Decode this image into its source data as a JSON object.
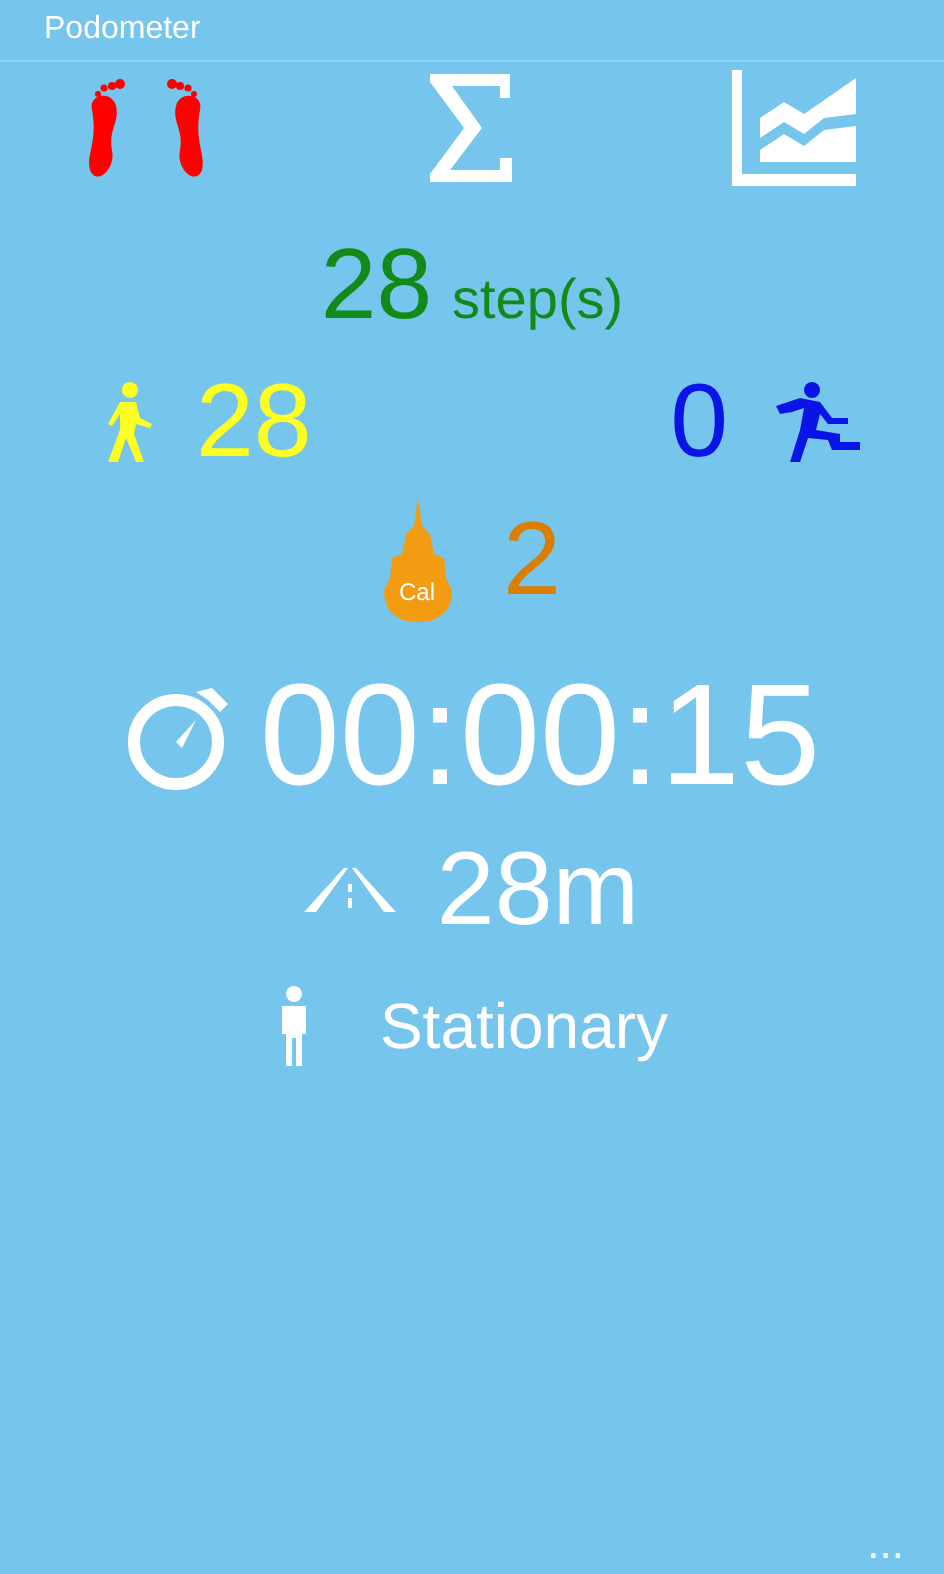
{
  "window": {
    "title": "Podometer"
  },
  "tabs": [
    {
      "kind": "footprints",
      "selected": true
    },
    {
      "kind": "sum",
      "selected": false
    },
    {
      "kind": "chart",
      "selected": false
    }
  ],
  "steps": {
    "value": "28",
    "unit": "step(s)"
  },
  "walking": {
    "value": "28"
  },
  "running": {
    "value": "0"
  },
  "calories": {
    "badge": "Cal",
    "value": "2"
  },
  "timer": {
    "value": "00:00:15"
  },
  "distance": {
    "value": "28m"
  },
  "activity": {
    "value": "Stationary"
  },
  "app_bar": {
    "more": "..."
  }
}
